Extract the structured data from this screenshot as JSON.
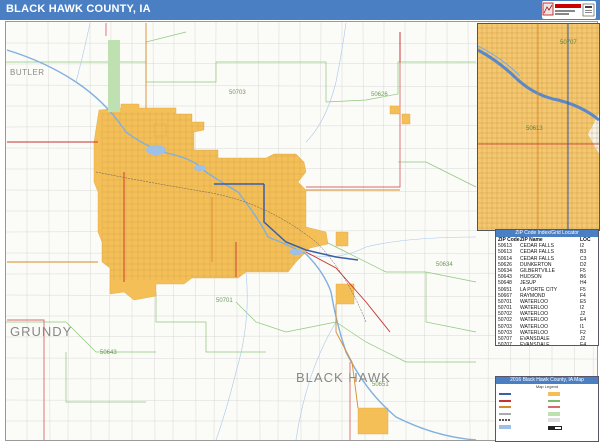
{
  "header": {
    "title": "BLACK HAWK COUNTY, IA"
  },
  "logo": {
    "icon": "market-maps-logo-icon",
    "colors": {
      "brand": "#cc0000",
      "header_bg": "#4a7fc4"
    }
  },
  "counties": {
    "butler": "BUTLER",
    "grundy": "GRUNDY",
    "black_hawk": "BLACK HAWK"
  },
  "zip_labels": {
    "z50703_north": "50703",
    "z50626": "50626",
    "z50613": "50613",
    "z50701": "50701",
    "z50634": "50634",
    "z50643": "50643",
    "z50651": "50651",
    "inset_top": "50707",
    "inset_mid": "50613"
  },
  "zip_table": {
    "title": "ZIP Code Index/Grid Locator",
    "columns": [
      "ZIP Code",
      "ZIP Name",
      "LOC"
    ],
    "rows": [
      [
        "50613",
        "CEDAR FALLS",
        "I2"
      ],
      [
        "50613",
        "CEDAR FALLS",
        "B3"
      ],
      [
        "50614",
        "CEDAR FALLS",
        "C3"
      ],
      [
        "50626",
        "DUNKERTON",
        "D2"
      ],
      [
        "50634",
        "GILBERTVILLE",
        "F5"
      ],
      [
        "50643",
        "HUDSON",
        "B6"
      ],
      [
        "50648",
        "JESUP",
        "H4"
      ],
      [
        "50651",
        "LA PORTE CITY",
        "F5"
      ],
      [
        "50667",
        "RAYMOND",
        "F4"
      ],
      [
        "50701",
        "WATERLOO",
        "E5"
      ],
      [
        "50701",
        "WATERLOO",
        "I2"
      ],
      [
        "50702",
        "WATERLOO",
        "J2"
      ],
      [
        "50702",
        "WATERLOO",
        "E4"
      ],
      [
        "50703",
        "WATERLOO",
        "I1"
      ],
      [
        "50703",
        "WATERLOO",
        "F2"
      ],
      [
        "50707",
        "EVANSDALE",
        "J2"
      ],
      [
        "50707",
        "EVANSDALE",
        "E4"
      ]
    ]
  },
  "legend": {
    "title": "2016 Black Hawk County, IA Map",
    "subtitle": "Map Legend",
    "colors": {
      "interstate": "#3a5fa8",
      "us_highway": "#c93030",
      "state_highway": "#d98a2a",
      "local_road": "#aaaaaa",
      "city_fill": "#f5bf58",
      "water": "#9cc0e8",
      "zip_boundary": "#7bbf6a",
      "county_boundary": "#d86a6a"
    }
  }
}
